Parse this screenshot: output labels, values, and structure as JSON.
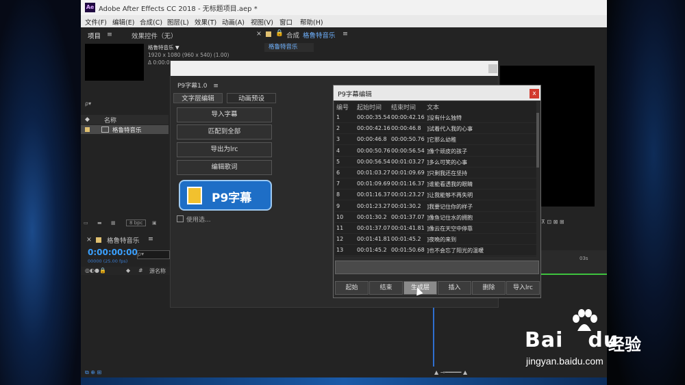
{
  "window": {
    "title": "Adobe After Effects CC 2018 - 无标题项目.aep *",
    "logo": "Ae"
  },
  "menu": [
    "文件(F)",
    "编辑(E)",
    "合成(C)",
    "图层(L)",
    "效果(T)",
    "动画(A)",
    "视图(V)",
    "窗口",
    "帮助(H)"
  ],
  "project_panel": {
    "tab_project": "项目",
    "tab_effects": "效果控件（无）",
    "comp_name": "格鲁特音乐 ▼",
    "comp_size": "1920 x 1080 (960 x 540) (1.00)",
    "comp_duration": "Δ 0:00:0",
    "col_name": "名称",
    "item_name": "格鲁特音乐",
    "bpc": "8 bpc"
  },
  "composition": {
    "tab_label": "合成",
    "tab_name": "格鲁特音乐",
    "sub_tab": "格鲁特音乐"
  },
  "timeline": {
    "name": "格鲁特音乐",
    "timecode": "0:00:00:00",
    "timecode_sub": "00000 (25.00 fps)",
    "search_placeholder": "ρ▾",
    "col_source": "源名称",
    "ruler_label": "03s"
  },
  "p9_panel": {
    "title": "P9字幕1.0",
    "tab_text_layer": "文字层编辑",
    "tab_anim_preset": "动画预设",
    "buttons": [
      "导入字幕",
      "匹配到全部",
      "导出为lrc",
      "编辑歌词"
    ],
    "logo_text": "P9字幕",
    "checkbox_label": "使用选..."
  },
  "subtitle_editor": {
    "title": "P9字幕编辑",
    "close": "x",
    "columns": [
      "编号",
      "起始时间",
      "结束时间",
      "文本"
    ],
    "rows": [
      {
        "n": "1",
        "start": "00:00:35.54",
        "end": "00:00:42.16",
        "text": "]没有什么独特"
      },
      {
        "n": "2",
        "start": "00:00:42.16",
        "end": "00:00:46.8",
        "text": "]试着代入我的心事"
      },
      {
        "n": "3",
        "start": "00:00:46.8",
        "end": "00:00:50.76",
        "text": "]它那么幼稚"
      },
      {
        "n": "4",
        "start": "00:00:50.76",
        "end": "00:00:56.54",
        "text": "]像个顽皮的孩子"
      },
      {
        "n": "5",
        "start": "00:00:56.54",
        "end": "00:01:03.27",
        "text": "]多么可笑的心事"
      },
      {
        "n": "6",
        "start": "00:01:03.27",
        "end": "00:01:09.69",
        "text": "]只剩我还在坚持"
      },
      {
        "n": "7",
        "start": "00:01:09.69",
        "end": "00:01:16.37",
        "text": "]谁能看透我的眼睛"
      },
      {
        "n": "8",
        "start": "00:01:16.37",
        "end": "00:01:23.27",
        "text": "]让我能够不再失明"
      },
      {
        "n": "9",
        "start": "00:01:23.27",
        "end": "00:01:30.2",
        "text": "]我要记住你的样子"
      },
      {
        "n": "10",
        "start": "00:01:30.2",
        "end": "00:01:37.07",
        "text": "]像鱼记住水的拥抱"
      },
      {
        "n": "11",
        "start": "00:01:37.07",
        "end": "00:01:41.81",
        "text": "]像云在天空中停靠"
      },
      {
        "n": "12",
        "start": "00:01:41.81",
        "end": "00:01:45.2",
        "text": "]夜晚的来到"
      },
      {
        "n": "13",
        "start": "00:01:45.2",
        "end": "00:01:50.68",
        "text": "]也不会忘了阳光的温暖"
      }
    ],
    "buttons": [
      "起始",
      "结束",
      "生成层",
      "插入",
      "删除",
      "导入lrc"
    ]
  },
  "watermark": {
    "brand": "Bai",
    "brand2": "du",
    "cn": "经验",
    "url": "jingyan.baidu.com"
  },
  "colors": {
    "accent_blue": "#3aa0ff",
    "close_red": "#d23a2e",
    "logo_blue": "#1e6ec6"
  }
}
